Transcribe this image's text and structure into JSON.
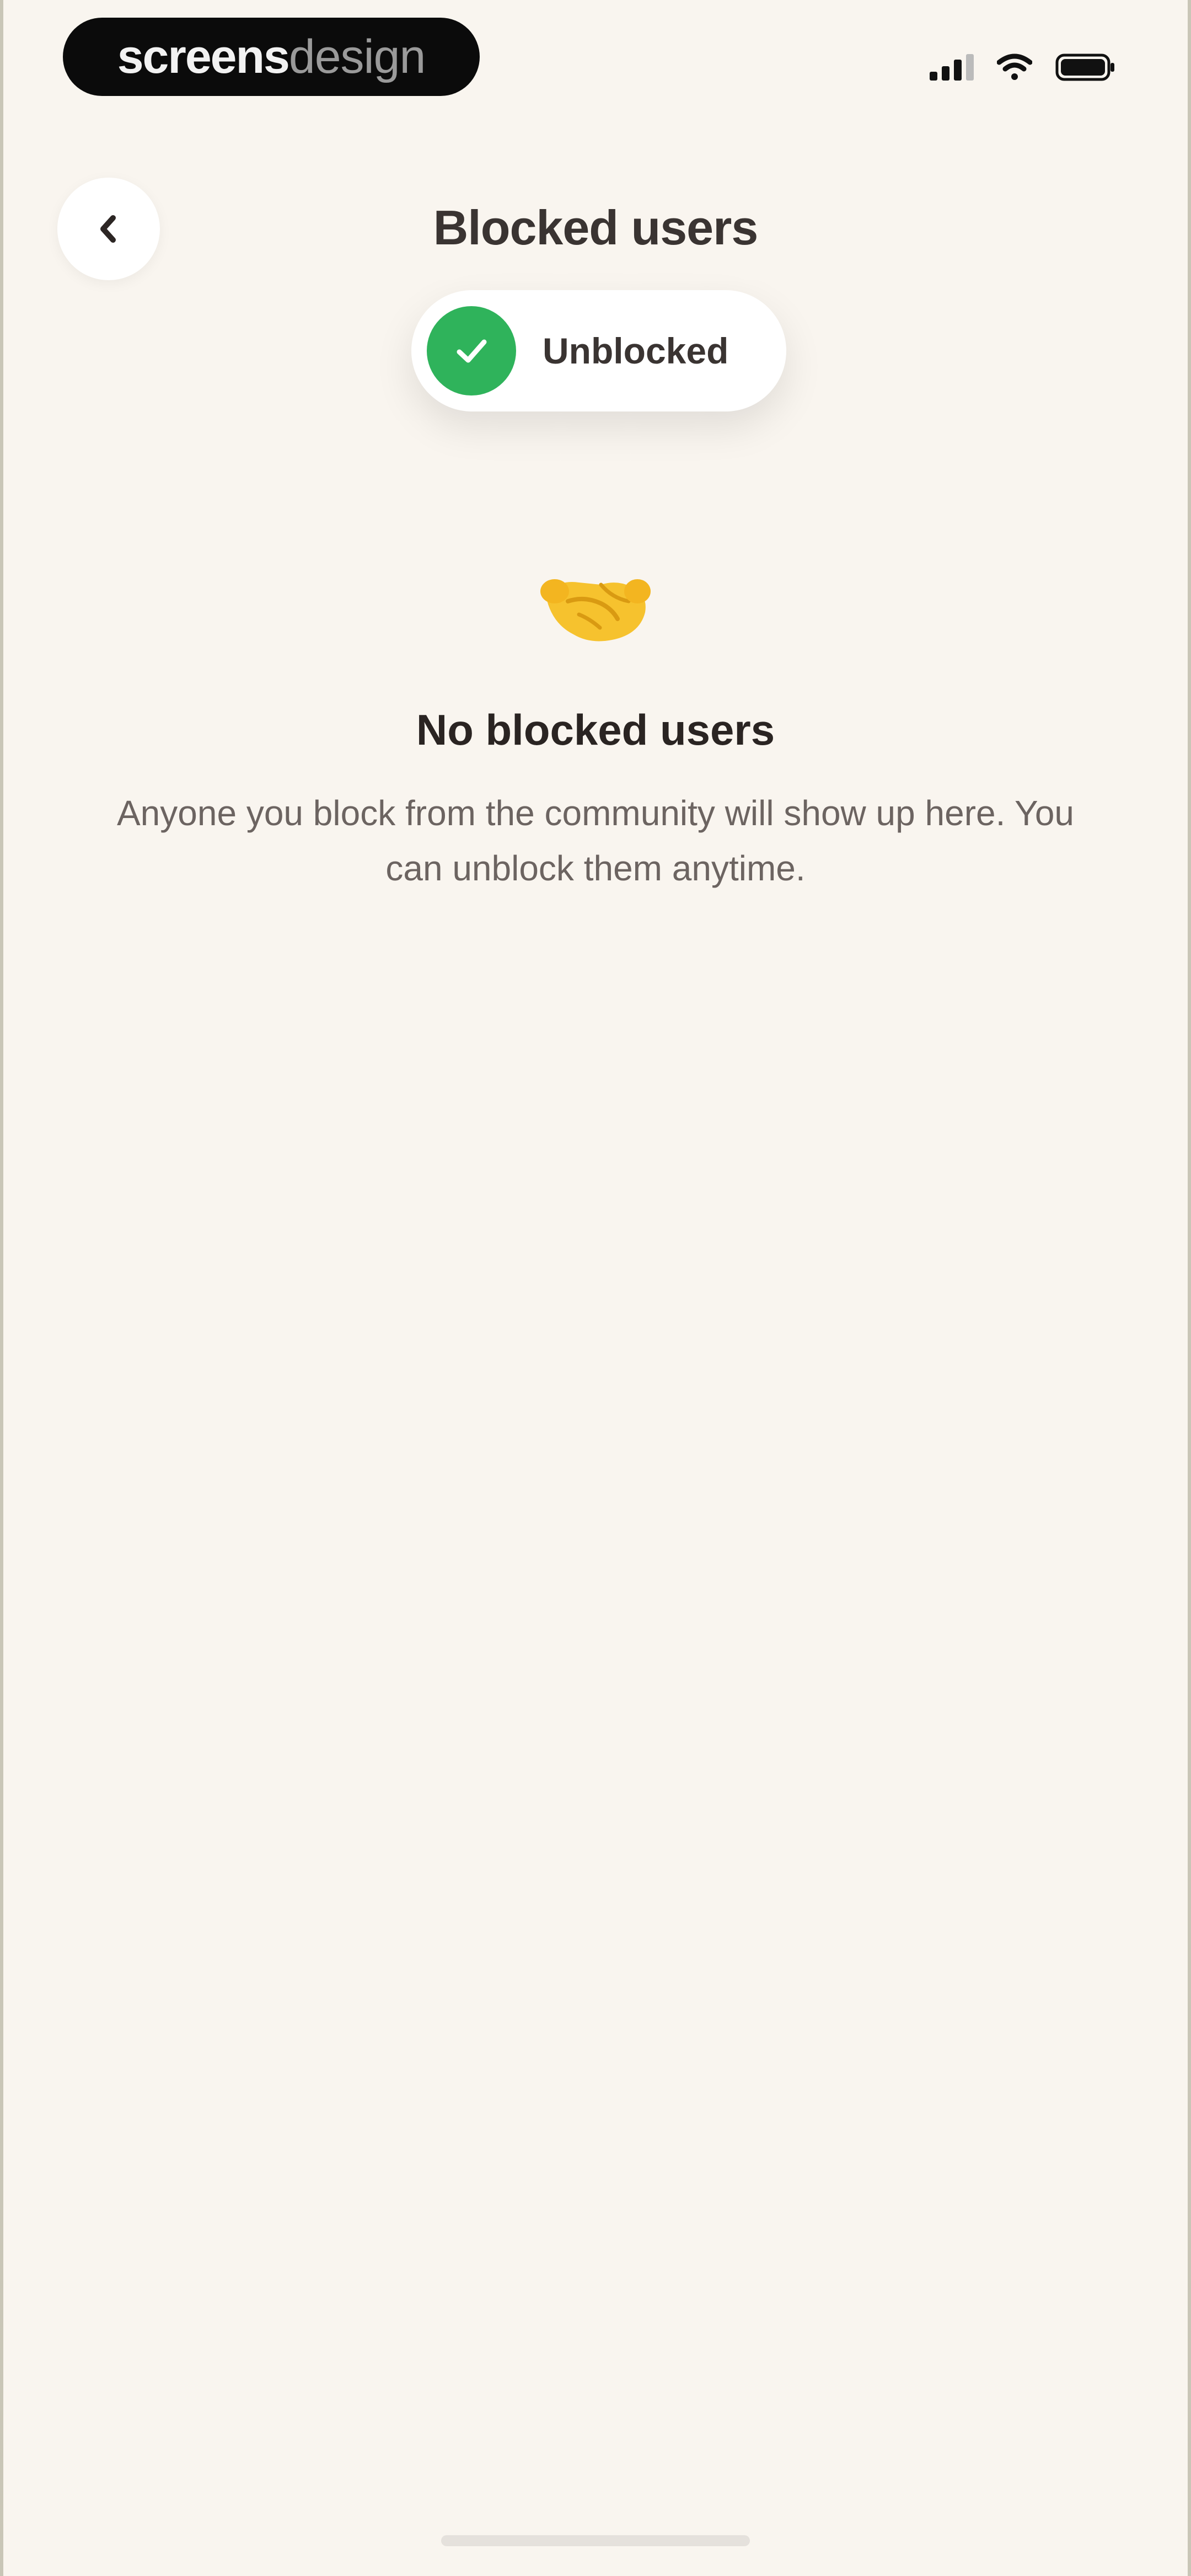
{
  "status_bar": {
    "brand_bold": "screens",
    "brand_light": "design",
    "icons": [
      "signal-icon",
      "wifi-icon",
      "battery-icon"
    ]
  },
  "header": {
    "title": "Blocked users",
    "back_icon": "chevron-left-icon"
  },
  "toast": {
    "label": "Unblocked",
    "icon": "check-icon",
    "accent": "#2fb35b"
  },
  "empty_state": {
    "icon": "handshake-icon",
    "title": "No blocked users",
    "description": "Anyone you block from the community will show up here. You can unblock them anytime."
  },
  "colors": {
    "background": "#f9f5ef",
    "text": "#2c2624",
    "muted_text": "#6c6461"
  }
}
